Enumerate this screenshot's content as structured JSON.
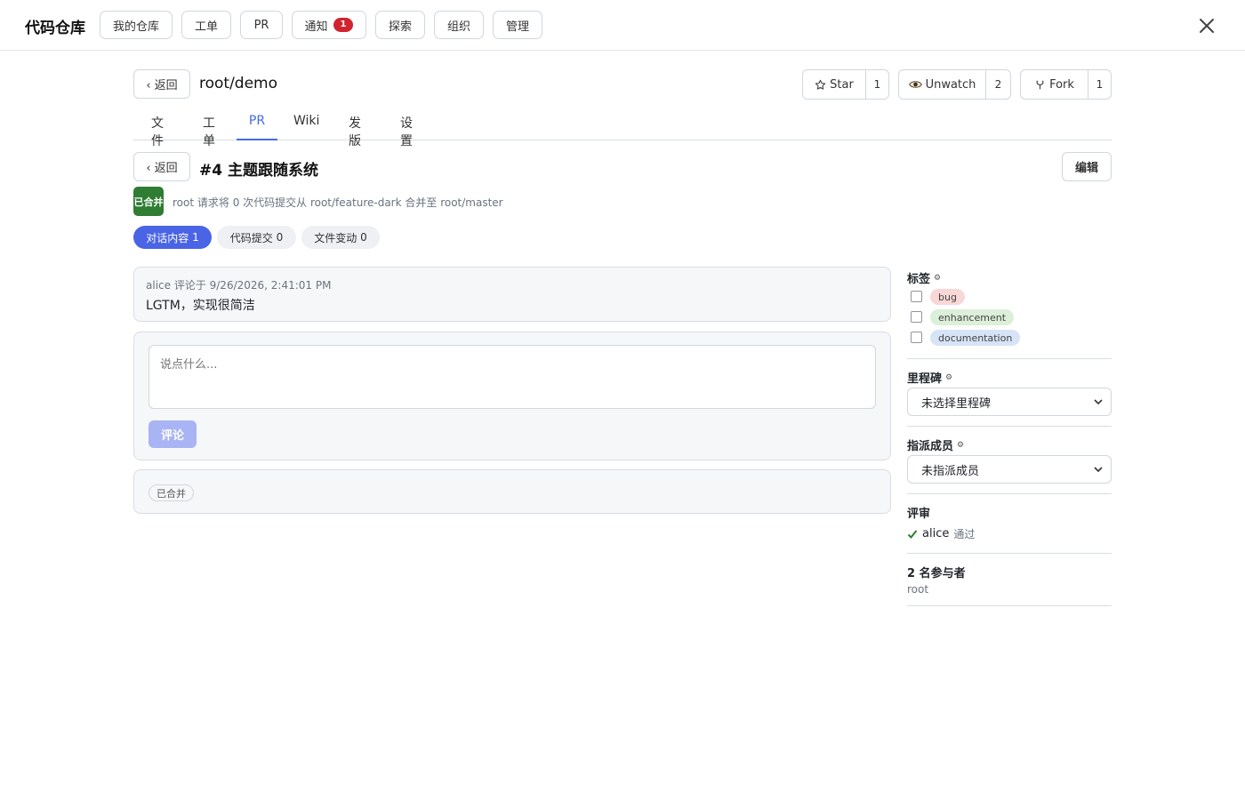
{
  "app": {
    "title": "代码仓库"
  },
  "nav": {
    "items": [
      {
        "label": "我的仓库"
      },
      {
        "label": "工单"
      },
      {
        "label": "PR"
      },
      {
        "label": "通知",
        "badge": "1"
      },
      {
        "label": "探索"
      },
      {
        "label": "组织"
      },
      {
        "label": "管理"
      }
    ],
    "close_icon": "close-icon"
  },
  "repo": {
    "back_label": "‹ 返回",
    "name": "root/demo",
    "star": {
      "label": "Star",
      "count": "1",
      "icon": "star-icon"
    },
    "watch": {
      "label": "Unwatch",
      "count": "2",
      "icon": "eye-icon"
    },
    "fork": {
      "label": "Fork",
      "count": "1",
      "icon": "fork-icon"
    },
    "tabs": [
      {
        "label": "文件"
      },
      {
        "label": "工单"
      },
      {
        "label": "PR",
        "active": true
      },
      {
        "label": "Wiki"
      },
      {
        "label": "发版"
      },
      {
        "label": "设置"
      }
    ]
  },
  "pr": {
    "back_label": "‹ 返回",
    "title": "#4 主题跟随系统",
    "edit_label": "编辑",
    "status": "已合并",
    "status_color": "#2e7d32",
    "meta": "root 请求将 0 次代码提交从 root/feature-dark 合并至 root/master",
    "tabs": [
      {
        "label": "对话内容",
        "count": "1",
        "active": true
      },
      {
        "label": "代码提交",
        "count": "0"
      },
      {
        "label": "文件变动",
        "count": "0"
      }
    ]
  },
  "conversation": {
    "comment": {
      "meta": "alice 评论于 9/26/2026, 2:41:01 PM",
      "body": "LGTM，实现很简洁"
    },
    "composer": {
      "placeholder": "说点什么...",
      "submit_label": "评论"
    },
    "state_tag": "已合并"
  },
  "sidebar": {
    "labels": {
      "title": "标签",
      "items": [
        {
          "name": "bug",
          "color": "#f8d7d7",
          "checked": false
        },
        {
          "name": "enhancement",
          "color": "#dcefd9",
          "checked": false
        },
        {
          "name": "documentation",
          "color": "#d7e3f7",
          "checked": false
        }
      ]
    },
    "milestone": {
      "title": "里程碑",
      "selected": "未选择里程碑"
    },
    "assignees": {
      "title": "指派成员",
      "selected": "未指派成员"
    },
    "reviews": {
      "title": "评审",
      "reviewer": "alice",
      "status": "通过",
      "icon": "check-icon"
    },
    "participants": {
      "title": "2 名参与者",
      "names": "root"
    }
  },
  "colors": {
    "accent": "#4669e8",
    "pill_active": "#4a64e6",
    "submit_disabled": "#a8b4f4",
    "badge_red": "#d1242f"
  }
}
